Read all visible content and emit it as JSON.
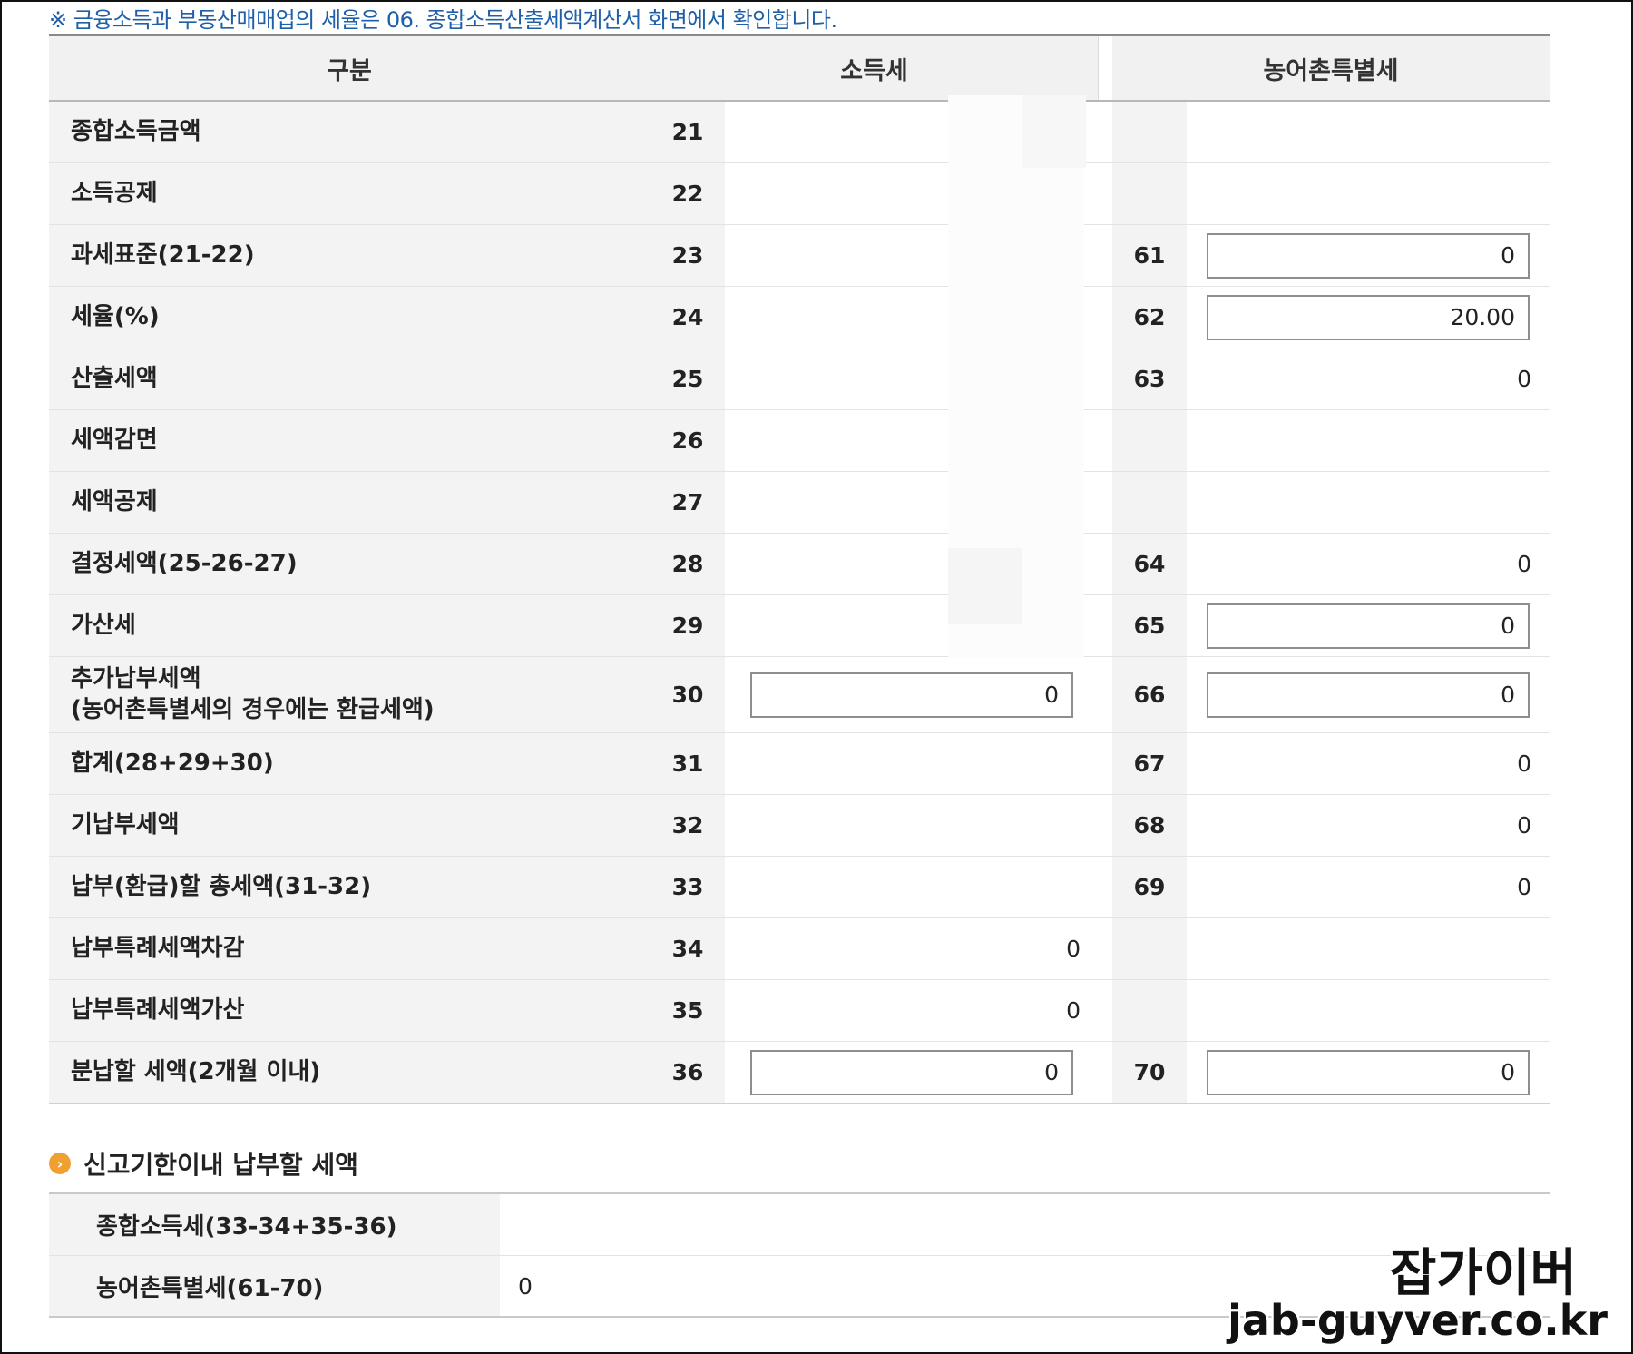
{
  "notice": "※ 금융소득과 부동산매매업의 세율은 06. 종합소득산출세액계산서 화면에서 확인합니다.",
  "table": {
    "headers": {
      "category": "구분",
      "income_tax": "소득세",
      "rural_tax": "농어촌특별세"
    },
    "rows": [
      {
        "label": "종합소득금액",
        "code": "21",
        "value": "",
        "code2": "",
        "value2": ""
      },
      {
        "label": "소득공제",
        "code": "22",
        "value": "",
        "code2": "",
        "value2": ""
      },
      {
        "label": "과세표준(21-22)",
        "code": "23",
        "value": "",
        "code2": "61",
        "value2": "0"
      },
      {
        "label": "세율(%)",
        "code": "24",
        "value": "",
        "code2": "62",
        "value2": "20.00"
      },
      {
        "label": "산출세액",
        "code": "25",
        "value": "",
        "code2": "63",
        "value2": "0"
      },
      {
        "label": "세액감면",
        "code": "26",
        "value": "",
        "code2": "",
        "value2": ""
      },
      {
        "label": "세액공제",
        "code": "27",
        "value": "",
        "code2": "",
        "value2": ""
      },
      {
        "label": "결정세액(25-26-27)",
        "code": "28",
        "value": "",
        "code2": "64",
        "value2": "0"
      },
      {
        "label": "가산세",
        "code": "29",
        "value": "",
        "code2": "65",
        "value2": "0"
      },
      {
        "label_line1": "추가납부세액",
        "label_line2": "(농어촌특별세의 경우에는 환급세액)",
        "code": "30",
        "value": "0",
        "code2": "66",
        "value2": "0"
      },
      {
        "label": "합계(28+29+30)",
        "code": "31",
        "value": "",
        "code2": "67",
        "value2": "0"
      },
      {
        "label": "기납부세액",
        "code": "32",
        "value": "",
        "code2": "68",
        "value2": "0"
      },
      {
        "label": "납부(환급)할 총세액(31-32)",
        "code": "33",
        "value": "",
        "code2": "69",
        "value2": "0"
      },
      {
        "label": "납부특례세액차감",
        "code": "34",
        "value": "0",
        "code2": "",
        "value2": ""
      },
      {
        "label": "납부특례세액가산",
        "code": "35",
        "value": "0",
        "code2": "",
        "value2": ""
      },
      {
        "label": "분납할 세액(2개월 이내)",
        "code": "36",
        "value": "0",
        "code2": "70",
        "value2": "0"
      }
    ]
  },
  "section": {
    "title": "신고기한이내 납부할 세액",
    "icon": "chevron-right-circle-icon",
    "accent": "#f0a030",
    "rows": [
      {
        "label": "종합소득세(33-34+35-36)",
        "value": ""
      },
      {
        "label": "농어촌특별세(61-70)",
        "value": "0"
      }
    ]
  },
  "watermark": {
    "name": "잡가이버",
    "url": "jab-guyver.co.kr"
  }
}
